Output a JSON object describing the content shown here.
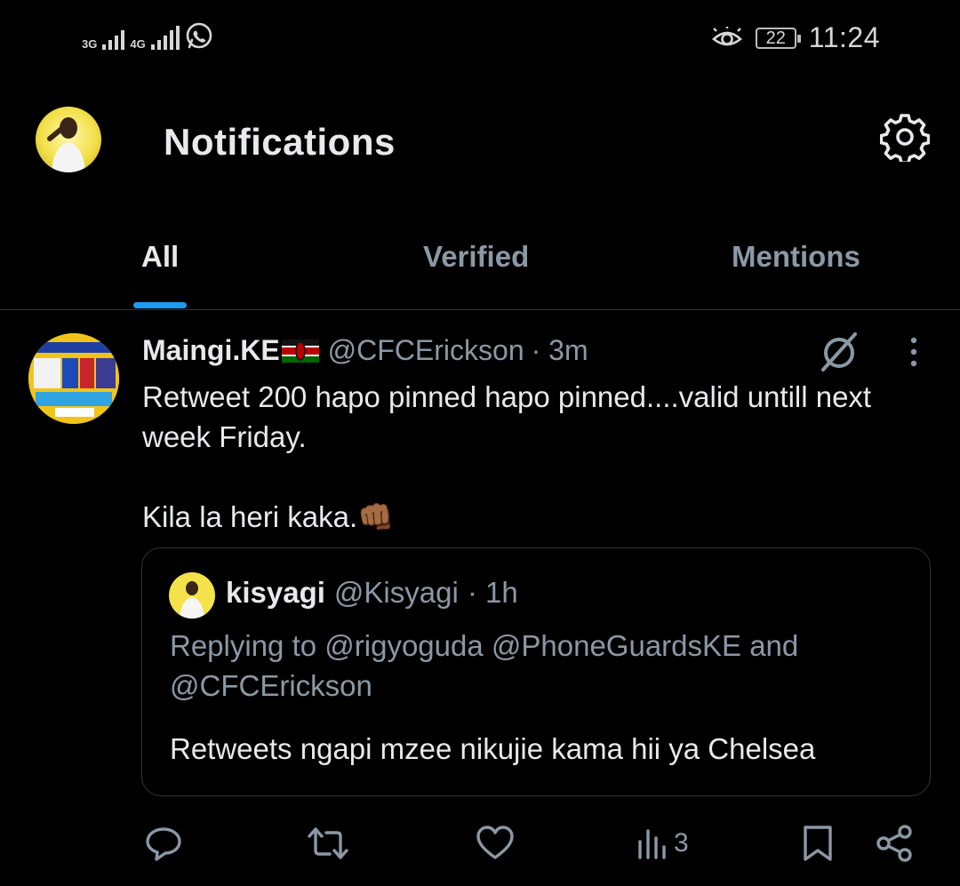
{
  "status_bar": {
    "network1": "3G",
    "network2": "4G",
    "battery": "22",
    "time": "11:24"
  },
  "header": {
    "title": "Notifications"
  },
  "tabs": [
    {
      "label": "All",
      "active": true
    },
    {
      "label": "Verified",
      "active": false
    },
    {
      "label": "Mentions",
      "active": false
    }
  ],
  "tweet": {
    "author_name": "Maingi.KE",
    "handle": "@CFCErickson",
    "time": "· 3m",
    "text_line1": "Retweet 200 hapo pinned hapo pinned....valid untill next week Friday.",
    "text_line2": "Kila la heri kaka.",
    "emoji": "👊🏾",
    "quote": {
      "author_name": "kisyagi",
      "handle": "@Kisyagi",
      "time": "· 1h",
      "reply_to": "Replying to @rigyoguda @PhoneGuardsKE and @CFCErickson",
      "text": "Retweets ngapi mzee nikujie kama hii ya Chelsea"
    },
    "actions": {
      "views": "3"
    }
  },
  "colors": {
    "background": "#000000",
    "accent": "#1d9bf0",
    "muted": "#8b98a5",
    "text": "#e7e9ea"
  }
}
